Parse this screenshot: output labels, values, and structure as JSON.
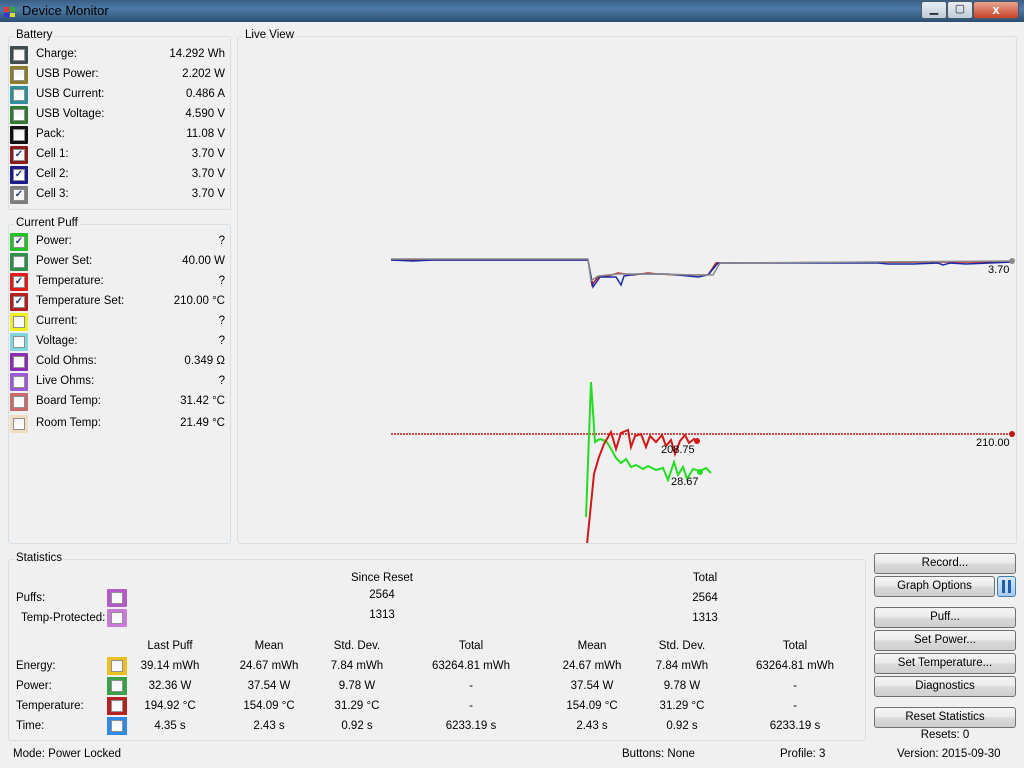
{
  "window": {
    "title": "Device Monitor",
    "minimize": "▁",
    "maximize": "▢",
    "close": "x"
  },
  "battery": {
    "title": "Battery",
    "items": [
      {
        "label": "Charge:",
        "value": "14.292 Wh",
        "color": "#404d50",
        "checked": false
      },
      {
        "label": "USB Power:",
        "value": "2.202 W",
        "color": "#8a7d2a",
        "checked": false
      },
      {
        "label": "USB Current:",
        "value": "0.486 A",
        "color": "#2d8f99",
        "checked": false
      },
      {
        "label": "USB Voltage:",
        "value": "4.590 V",
        "color": "#2e7a2e",
        "checked": false
      },
      {
        "label": "Pack:",
        "value": "11.08 V",
        "color": "#111111",
        "checked": false
      },
      {
        "label": "Cell 1:",
        "value": "3.70 V",
        "color": "#8b1a1a",
        "checked": true
      },
      {
        "label": "Cell 2:",
        "value": "3.70 V",
        "color": "#1a1a8b",
        "checked": true
      },
      {
        "label": "Cell 3:",
        "value": "3.70 V",
        "color": "#7d7d7d",
        "checked": true
      }
    ]
  },
  "current_puff": {
    "title": "Current Puff",
    "items": [
      {
        "label": "Power:",
        "value": "?",
        "color": "#22c322",
        "checked": true
      },
      {
        "label": "Power Set:",
        "value": "40.00 W",
        "color": "#2d8f4a",
        "checked": false
      },
      {
        "label": "Temperature:",
        "value": "?",
        "color": "#e01b1b",
        "checked": true
      },
      {
        "label": "Temperature Set:",
        "value": "210.00 °C",
        "color": "#b41e1e",
        "checked": true
      },
      {
        "label": "Current:",
        "value": "?",
        "color": "#f0f020",
        "checked": false
      },
      {
        "label": "Voltage:",
        "value": "?",
        "color": "#7fd6dc",
        "checked": false
      },
      {
        "label": "Cold Ohms:",
        "value": "0.349 Ω",
        "color": "#8a2db4",
        "checked": false
      },
      {
        "label": "Live Ohms:",
        "value": "?",
        "color": "#9c5ad6",
        "checked": false
      },
      {
        "label": "Board Temp:",
        "value": "31.42 °C",
        "color": "#c86a6a",
        "checked": false
      },
      {
        "label": "Room Temp:",
        "value": "21.49 °C",
        "color": "#f2dcc0",
        "checked": false
      }
    ]
  },
  "live_view": {
    "title": "Live View",
    "cell_label": "3.70",
    "temp_set_label": "210.00",
    "temp_label": "208.75",
    "power_label": "28.67"
  },
  "statistics": {
    "title": "Statistics",
    "since_reset": "Since Reset",
    "total": "Total",
    "puffs_label": "Puffs:",
    "temp_protected_label": "Temp-Protected:",
    "puffs_color": "#b55ac8",
    "temp_protected_color": "#c87ad6",
    "puffs_since": "2564",
    "puffs_total": "2564",
    "tp_since": "1313",
    "tp_total": "1313",
    "headers": [
      "Last Puff",
      "Mean",
      "Std. Dev.",
      "Total",
      "Mean",
      "Std. Dev.",
      "Total"
    ],
    "rows": [
      {
        "label": "Energy:",
        "color": "#e8c020",
        "cells": [
          "39.14 mWh",
          "24.67 mWh",
          "7.84 mWh",
          "63264.81 mWh",
          "24.67 mWh",
          "7.84 mWh",
          "63264.81 mWh"
        ]
      },
      {
        "label": "Power:",
        "color": "#3aa04a",
        "cells": [
          "32.36 W",
          "37.54 W",
          "9.78 W",
          "-",
          "37.54 W",
          "9.78 W",
          "-"
        ]
      },
      {
        "label": "Temperature:",
        "color": "#b42222",
        "cells": [
          "194.92 °C",
          "154.09 °C",
          "31.29 °C",
          "-",
          "154.09 °C",
          "31.29 °C",
          "-"
        ]
      },
      {
        "label": "Time:",
        "color": "#2e8ae6",
        "cells": [
          "4.35 s",
          "2.43 s",
          "0.92 s",
          "6233.19 s",
          "2.43 s",
          "0.92 s",
          "6233.19 s"
        ]
      }
    ]
  },
  "buttons": {
    "record": "Record...",
    "graph_options": "Graph Options",
    "puff": "Puff...",
    "set_power": "Set Power...",
    "set_temperature": "Set Temperature...",
    "diagnostics": "Diagnostics",
    "reset_statistics": "Reset Statistics",
    "resets": "Resets: 0"
  },
  "status": {
    "mode": "Mode: Power Locked",
    "buttons": "Buttons: None",
    "profile": "Profile: 3",
    "version": "Version: 2015-09-30"
  }
}
